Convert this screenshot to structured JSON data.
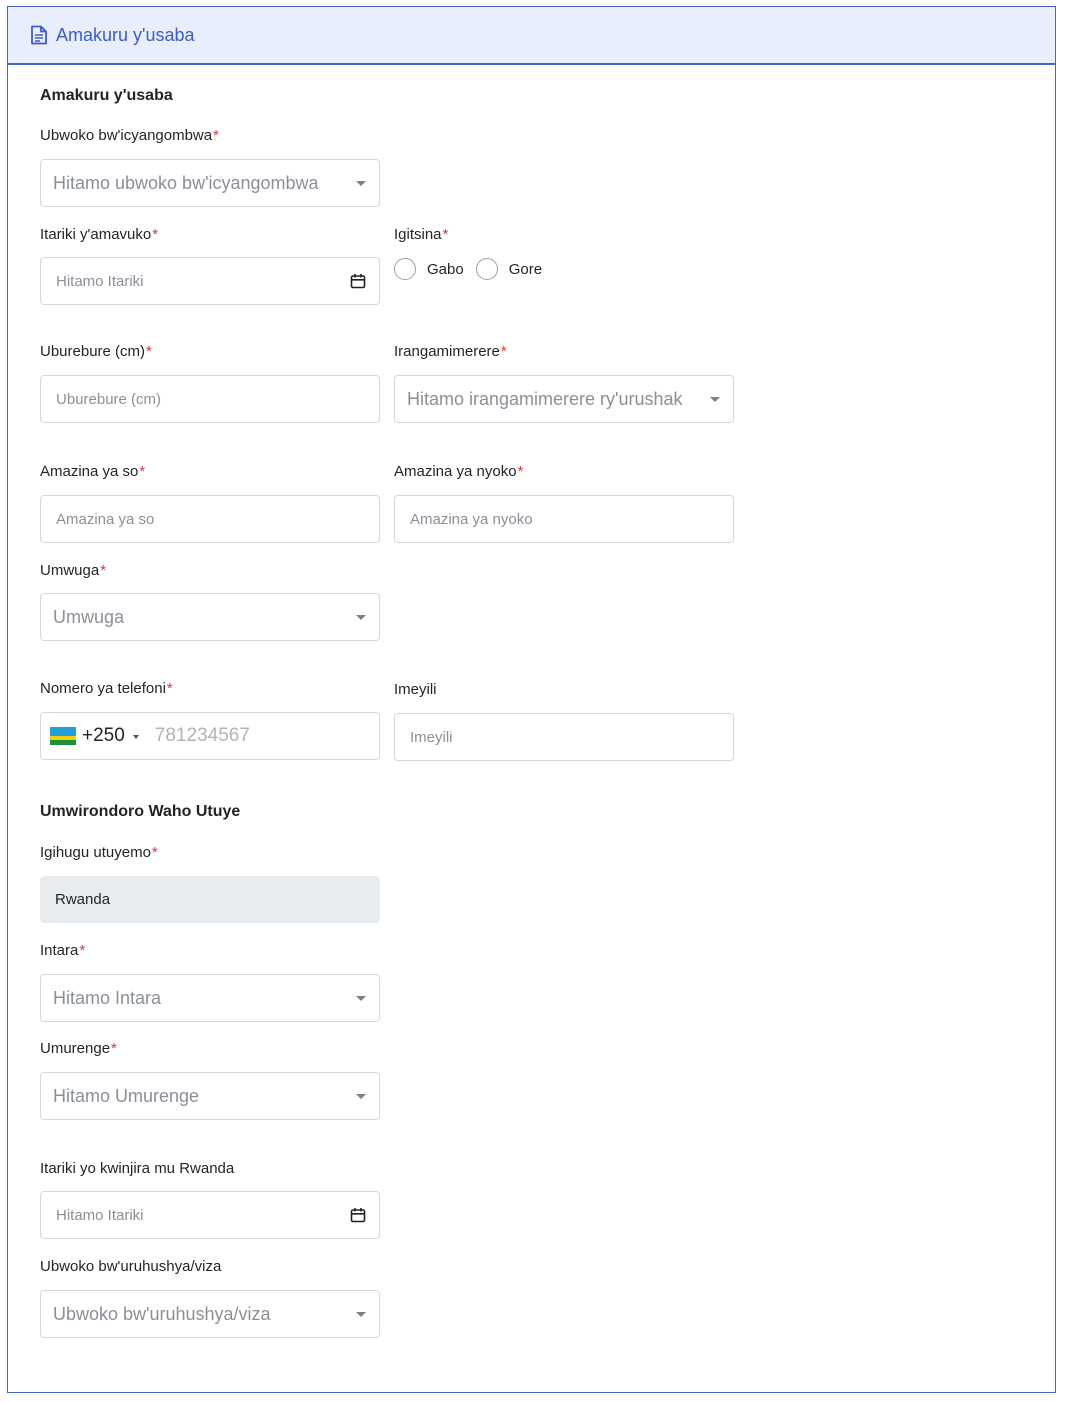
{
  "header": {
    "title": "Amakuru y'usaba",
    "icon": "document-icon"
  },
  "sections": {
    "applicant": "Amakuru y'usaba",
    "address": "Umwirondoro Waho Utuye"
  },
  "required_mark": "*",
  "fields": {
    "document_type": {
      "label": "Ubwoko bw'icyangombwa",
      "placeholder": "Hitamo ubwoko bw'icyangombwa"
    },
    "birth_date": {
      "label": "Itariki y'amavuko",
      "placeholder": "Hitamo Itariki"
    },
    "gender": {
      "label": "Igitsina",
      "options": [
        "Gabo",
        "Gore"
      ]
    },
    "height": {
      "label": "Uburebure (cm)",
      "placeholder": "Uburebure (cm)"
    },
    "eye_color": {
      "label": "Irangamimerere",
      "placeholder": "Hitamo irangamimerere ry'urushak"
    },
    "father_name": {
      "label": "Amazina ya so",
      "placeholder": "Amazina ya so"
    },
    "mother_name": {
      "label": "Amazina ya nyoko",
      "placeholder": "Amazina ya nyoko"
    },
    "occupation": {
      "label": "Umwuga",
      "placeholder": "Umwuga"
    },
    "phone": {
      "label": "Nomero ya telefoni",
      "dial_code": "+250",
      "placeholder": "781234567"
    },
    "email": {
      "label": "Imeyili",
      "placeholder": "Imeyili"
    },
    "country": {
      "label": "Igihugu utuyemo",
      "value": "Rwanda"
    },
    "province": {
      "label": "Intara",
      "placeholder": "Hitamo Intara"
    },
    "sector": {
      "label": "Umurenge",
      "placeholder": "Hitamo Umurenge"
    },
    "entry_date": {
      "label": "Itariki yo kwinjira mu Rwanda",
      "placeholder": "Hitamo Itariki"
    },
    "visa_type": {
      "label": "Ubwoko bw'uruhushya/viza",
      "placeholder": "Ubwoko bw'uruhushya/viza"
    }
  },
  "colors": {
    "accent": "#3d5bc9",
    "header_bg": "#e8eefb",
    "required": "#d9363e",
    "border": "#d4d7dd"
  }
}
